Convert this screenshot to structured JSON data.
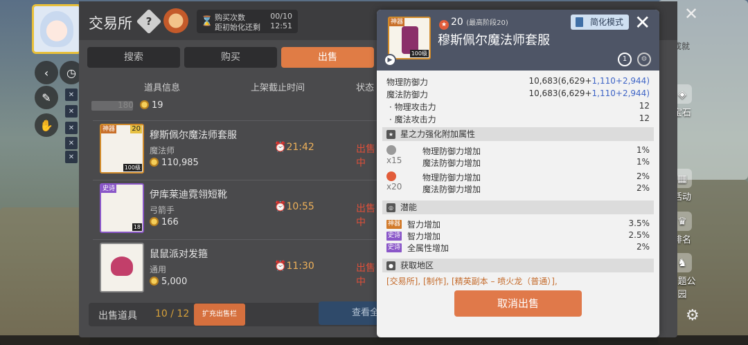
{
  "trade": {
    "title": "交易所",
    "limits": {
      "purchase_label": "购买次数",
      "purchase_value": "00/10",
      "reset_label": "距初始化还剩",
      "reset_value": "12:51"
    },
    "tabs": [
      "搜索",
      "购买",
      "出售"
    ],
    "active_tab": "出售",
    "columns": {
      "info": "道具信息",
      "time": "上架截止时间",
      "status": "状态"
    },
    "partial_row": {
      "stars": "180",
      "price": "19"
    },
    "items": [
      {
        "name": "穆斯佩尔魔法师套服",
        "class": "魔法师",
        "price": "110,985",
        "time": "21:42",
        "status": "出售中",
        "grade": "神器",
        "star": "20",
        "level": "100级"
      },
      {
        "name": "伊库莱迪霓翎短靴",
        "class": "弓箭手",
        "price": "166",
        "time": "10:55",
        "status": "出售中",
        "grade": "史诗",
        "level": "18"
      },
      {
        "name": "鼠鼠派对发箍",
        "class": "通用",
        "price": "5,000",
        "time": "11:30",
        "status": "出售中",
        "grade": ""
      }
    ],
    "footer": {
      "label": "出售道具",
      "count": "10 / 12",
      "expand": "扩充出售栏",
      "view_all": "查看全"
    }
  },
  "detail": {
    "grade": "神器",
    "level": "100级",
    "star_count": "20",
    "star_max": "(最高阶段20)",
    "name": "穆斯佩尔魔法师套服",
    "simple_mode": "简化模式",
    "stats": {
      "phys_def_label": "物理防御力",
      "phys_def_value": "10,683(6,629+",
      "phys_def_blue": "1,110",
      "phys_def_tail": "+2,944)",
      "mag_def_label": "魔法防御力",
      "mag_def_value": "10,683(6,629+",
      "mag_def_blue": "1,110",
      "mag_def_tail": "+2,944)",
      "phys_atk_label": "· 物理攻击力",
      "phys_atk_value": "12",
      "mag_atk_label": "· 魔法攻击力",
      "mag_atk_value": "12"
    },
    "star_section": "星之力强化附加属性",
    "star_rows": [
      {
        "badge": "x15",
        "lines": [
          {
            "label": "物理防御力增加",
            "value": "1%"
          },
          {
            "label": "魔法防御力增加",
            "value": "1%"
          }
        ]
      },
      {
        "badge": "x20",
        "lines": [
          {
            "label": "物理防御力增加",
            "value": "2%"
          },
          {
            "label": "魔法防御力增加",
            "value": "2%"
          }
        ]
      }
    ],
    "potential_section": "潜能",
    "potentials": [
      {
        "tag": "神器",
        "label": "智力增加",
        "value": "3.5%"
      },
      {
        "tag": "史诗",
        "label": "智力增加",
        "value": "2.5%"
      },
      {
        "tag": "史诗",
        "label": "全属性增加",
        "value": "2%"
      }
    ],
    "obtain_section": "获取地区",
    "obtain_text": "[交易所], [制作], [精英副本 – 喷火龙（普通）],",
    "cancel": "取消出售"
  },
  "hud": {
    "right_items": [
      "宝石",
      "活动",
      "排名",
      "主题公园"
    ],
    "right_top": "成就"
  }
}
